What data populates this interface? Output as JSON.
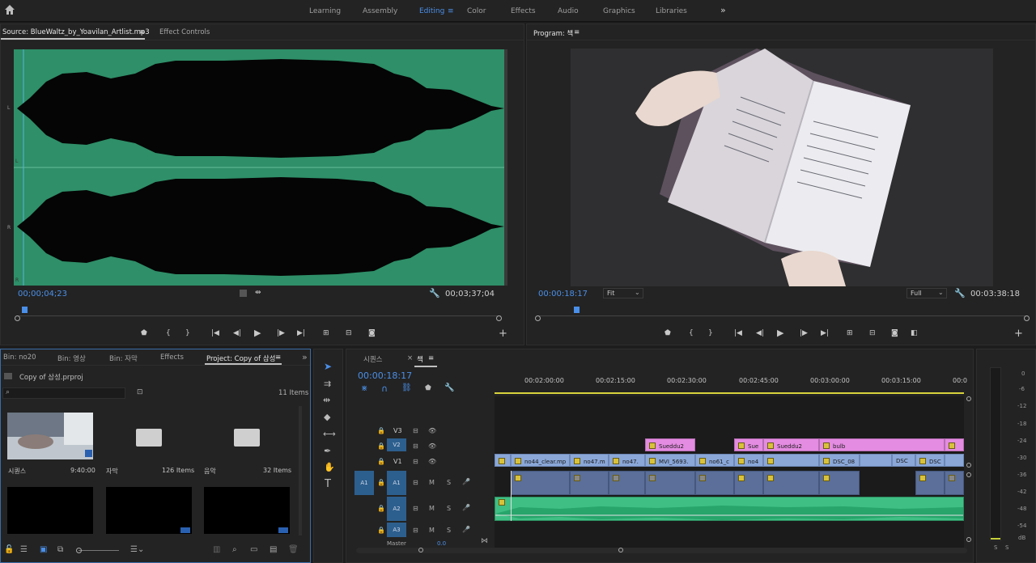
{
  "workspaces": {
    "items": [
      "Learning",
      "Assembly",
      "Editing",
      "Color",
      "Effects",
      "Audio",
      "Graphics",
      "Libraries"
    ],
    "more": "»"
  },
  "source": {
    "tab": "Source: BlueWaltz_by_Yoavilan_Artlist.mp3",
    "tab2": "Effect Controls",
    "menu": "≡",
    "ch_l": "L",
    "ch_l2": "L",
    "ch_r": "R",
    "ch_r2": "R",
    "timecode": "00;00;04;23",
    "duration": "00;03;37;04",
    "add": "+"
  },
  "program": {
    "tab": "Program: 책",
    "menu": "≡",
    "timecode": "00:00:18:17",
    "fit": "Fit",
    "quality": "Full",
    "duration": "00:03:38:18",
    "add": "+"
  },
  "project": {
    "tabs": [
      "Bin: no20",
      "Bin: 영상",
      "Bin: 자막",
      "Effects",
      "Project: Copy of 삼성"
    ],
    "menu": "≡",
    "more": "»",
    "file": "Copy of 삼성.prproj",
    "count": "11 Items",
    "items": [
      {
        "name": "시퀀스",
        "meta": "9:40:00"
      },
      {
        "name": "자막",
        "meta": "126 Items"
      },
      {
        "name": "음악",
        "meta": "32 Items"
      }
    ]
  },
  "timeline": {
    "tab1": "시퀀스",
    "tab1_close": "×",
    "tab2": "책",
    "menu": "≡",
    "timecode": "00:00:18:17",
    "ruler": [
      "00:02:00:00",
      "00:02:15:00",
      "00:02:30:00",
      "00:02:45:00",
      "00:03:00:00",
      "00:03:15:00",
      "00:0"
    ],
    "tracks": {
      "v3": "V3",
      "v2": "V2",
      "v1": "V1",
      "a1src": "A1",
      "a1": "A1",
      "a2": "A2",
      "a3": "A3",
      "master": "Master",
      "master_val": "0.0",
      "m": "M",
      "s": "S"
    },
    "v2clips": [
      "Sueddu2",
      "Sue",
      "Sueddu2",
      "bulb"
    ],
    "v1clips": [
      "no44_clear.mp",
      "no47.m",
      "no47.",
      "MVI_5693.",
      "no61_c",
      "no4",
      "DSC_08",
      "DSC",
      "DSC"
    ]
  },
  "meters": {
    "scale": [
      "0",
      "-6",
      "-12",
      "-18",
      "-24",
      "-30",
      "-36",
      "-42",
      "-48",
      "-54",
      "dB"
    ],
    "s1": "S",
    "s2": "S"
  },
  "colors": {
    "accent": "#4a8fe8",
    "waveform_bg": "#2e8f68",
    "v2clip": "#e48ce1",
    "v1clip": "#8aa7d8",
    "audio_green": "#3fbf84"
  }
}
